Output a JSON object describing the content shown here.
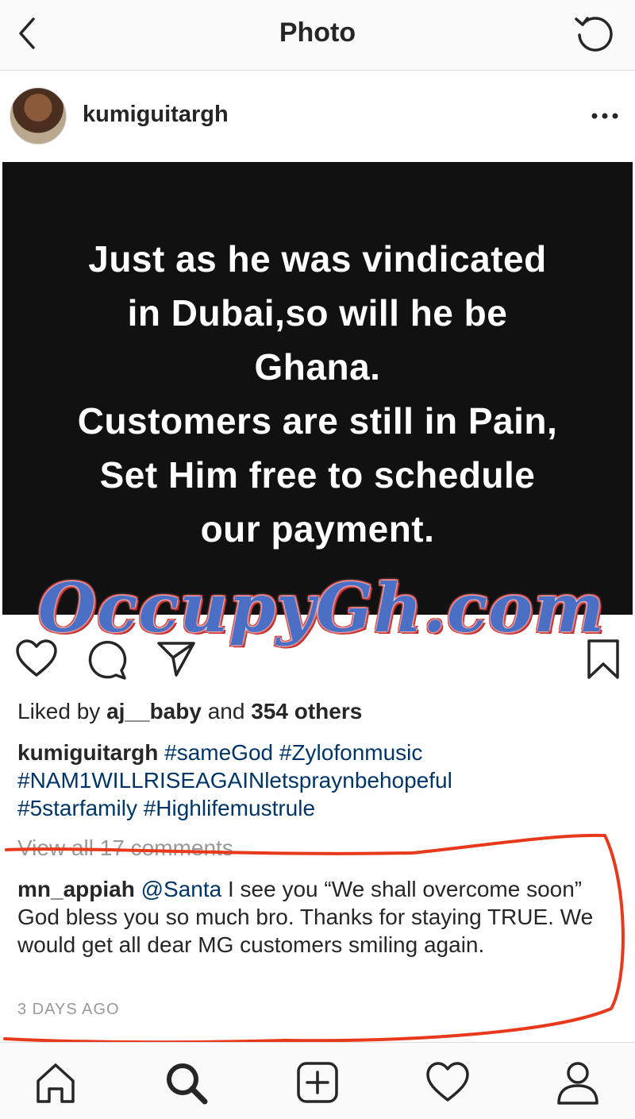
{
  "header": {
    "title": "Photo",
    "back_icon": "chevron-left-icon",
    "refresh_icon": "refresh-icon"
  },
  "post": {
    "username": "kumiguitargh",
    "more_icon": "ellipsis-icon",
    "image_text": [
      "Just as he was vindicated",
      "in Dubai,so will he be",
      "Ghana.",
      "Customers are still in Pain,",
      "Set Him free to schedule",
      "our payment."
    ],
    "watermark": "OccupyGh.com",
    "likes": {
      "prefix": "Liked by",
      "first_user": "aj__baby",
      "middle": "and",
      "count_text": "354 others"
    },
    "caption": {
      "username": "kumiguitargh",
      "tags": [
        "#sameGod",
        "#Zylofonmusic",
        "#NAM1WILLRISEAGAINletspraynbehopeful",
        "#5starfamily",
        "#Highlifemustrule"
      ]
    },
    "view_all_comments": "View all 17 comments",
    "comment": {
      "username": "mn_appiah",
      "mention": "@Santa",
      "text": "I see you “We shall overcome soon” God bless you so much bro. Thanks for staying TRUE. We would get all dear MG customers smiling again."
    },
    "timestamp": "3 DAYS AGO"
  },
  "colors": {
    "link": "#003569",
    "muted": "#999999",
    "annotation_red": "#e8391c",
    "watermark_blue": "#4b6fc4"
  },
  "bottom_nav": [
    "home-icon",
    "search-icon",
    "new-post-icon",
    "activity-heart-icon",
    "profile-icon"
  ]
}
